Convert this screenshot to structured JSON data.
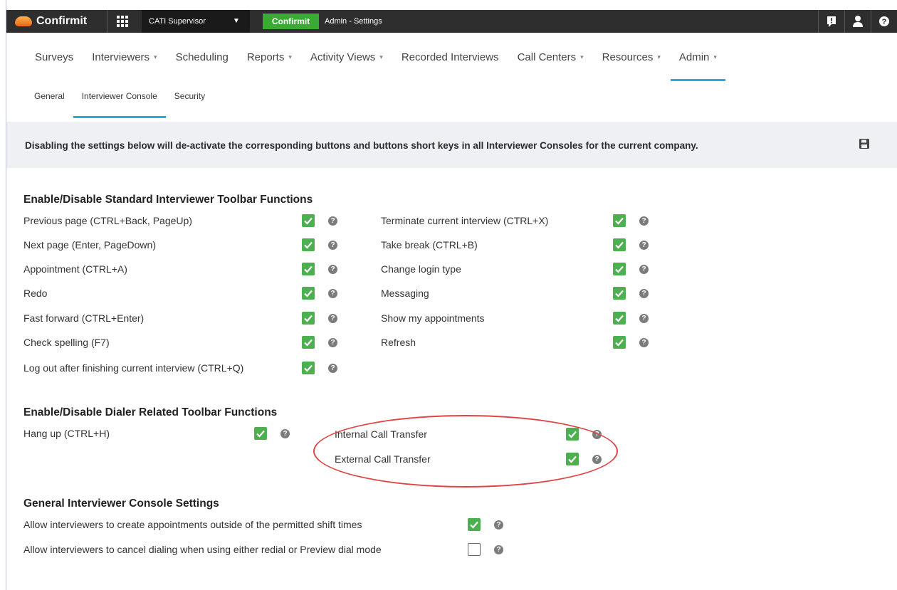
{
  "app": {
    "logo_text": "Confirmit"
  },
  "topbar": {
    "workspace": "CATI Supervisor",
    "product": "Confirmit",
    "breadcrumb": "Admin - Settings",
    "icons": [
      "message-icon",
      "user-icon",
      "help-icon"
    ]
  },
  "nav": {
    "items": [
      {
        "label": "Surveys",
        "dropdown": false
      },
      {
        "label": "Interviewers",
        "dropdown": true
      },
      {
        "label": "Scheduling",
        "dropdown": false
      },
      {
        "label": "Reports",
        "dropdown": true
      },
      {
        "label": "Activity Views",
        "dropdown": true
      },
      {
        "label": "Recorded Interviews",
        "dropdown": false
      },
      {
        "label": "Call Centers",
        "dropdown": true
      },
      {
        "label": "Resources",
        "dropdown": true
      },
      {
        "label": "Admin",
        "dropdown": true,
        "active": true
      }
    ],
    "dropdown_glyph": "▾"
  },
  "subnav": {
    "items": [
      {
        "label": "General"
      },
      {
        "label": "Interviewer Console",
        "active": true
      },
      {
        "label": "Security"
      }
    ]
  },
  "banner": {
    "message": "Disabling the settings below will de-activate the corresponding buttons and buttons short keys in all Interviewer Consoles for the current company."
  },
  "sections": {
    "standard": {
      "title": "Enable/Disable Standard Interviewer Toolbar Functions",
      "left": [
        {
          "label": "Previous page (CTRL+Back, PageUp)",
          "checked": true
        },
        {
          "label": "Next page (Enter, PageDown)",
          "checked": true
        },
        {
          "label": "Appointment (CTRL+A)",
          "checked": true
        },
        {
          "label": "Redo",
          "checked": true
        },
        {
          "label": "Fast forward (CTRL+Enter)",
          "checked": true
        },
        {
          "label": "Check spelling (F7)",
          "checked": true
        },
        {
          "label": "Log out after finishing current interview (CTRL+Q)",
          "checked": true
        }
      ],
      "right": [
        {
          "label": "Terminate current interview (CTRL+X)",
          "checked": true
        },
        {
          "label": "Take break (CTRL+B)",
          "checked": true
        },
        {
          "label": "Change login type",
          "checked": true
        },
        {
          "label": "Messaging",
          "checked": true
        },
        {
          "label": "Show my appointments",
          "checked": true
        },
        {
          "label": "Refresh",
          "checked": true
        }
      ]
    },
    "dialer": {
      "title": "Enable/Disable Dialer Related Toolbar Functions",
      "left": [
        {
          "label": "Hang up (CTRL+H)",
          "checked": true
        }
      ],
      "right": [
        {
          "label": "Internal Call Transfer",
          "checked": true
        },
        {
          "label": "External Call Transfer",
          "checked": true
        }
      ]
    },
    "general": {
      "title": "General Interviewer Console Settings",
      "items": [
        {
          "label": "Allow interviewers to create appointments outside of the permitted shift times",
          "checked": true
        },
        {
          "label": "Allow interviewers to cancel dialing when using either redial or Preview dial mode",
          "checked": false
        }
      ]
    }
  },
  "help_glyph": "?",
  "colors": {
    "accent": "#29abe2",
    "brand_green": "#3aaa35",
    "checkbox_green": "#4caf50",
    "highlight": "#e04545"
  }
}
